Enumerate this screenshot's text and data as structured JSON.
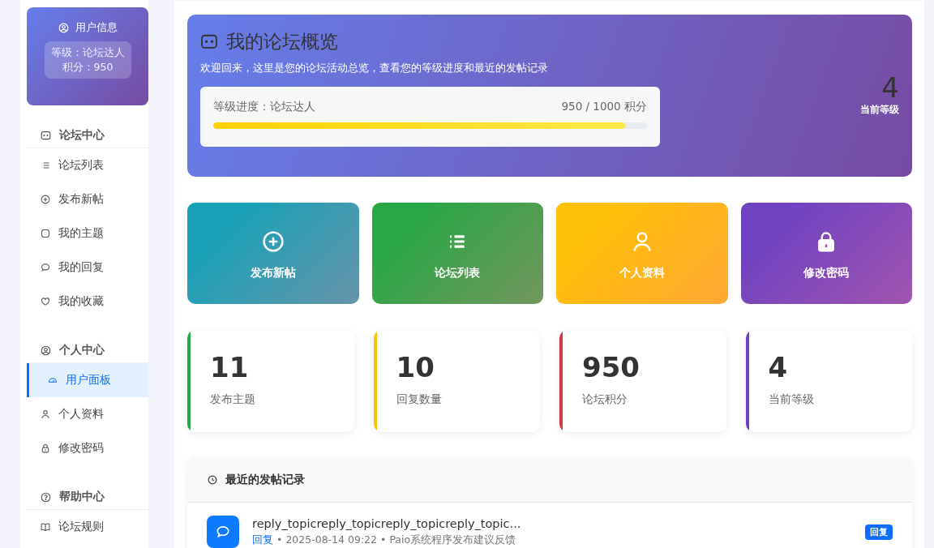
{
  "sidebar": {
    "user_card": {
      "title": "用户信息",
      "level": "等级：论坛达人",
      "points": "积分：950"
    },
    "sections": [
      {
        "title": "论坛中心",
        "items": [
          {
            "label": "论坛列表",
            "selected": false
          },
          {
            "label": "发布新帖",
            "selected": false
          },
          {
            "label": "我的主题",
            "selected": false
          },
          {
            "label": "我的回复",
            "selected": false
          },
          {
            "label": "我的收藏",
            "selected": false
          }
        ]
      },
      {
        "title": "个人中心",
        "items": [
          {
            "label": "用户面板",
            "selected": true
          },
          {
            "label": "个人资料",
            "selected": false
          },
          {
            "label": "修改密码",
            "selected": false
          }
        ]
      },
      {
        "title": "帮助中心",
        "items": [
          {
            "label": "论坛规则",
            "selected": false
          }
        ]
      }
    ]
  },
  "hero": {
    "title": "我的论坛概览",
    "subtitle": "欢迎回来，这里是您的论坛活动总览，查看您的等级进度和最近的发帖记录",
    "progress_label": "等级进度：论坛达人",
    "progress_value": "950 / 1000 积分",
    "level": 0.95,
    "current_level": "4",
    "current_level_label": "当前等级"
  },
  "quick_actions": [
    {
      "label": "发布新帖",
      "color": "#17a2b8"
    },
    {
      "label": "论坛列表",
      "color": "#28a745"
    },
    {
      "label": "个人资料",
      "color": "#ffc107"
    },
    {
      "label": "修改密码",
      "color": "#6f42c1"
    }
  ],
  "stats": [
    {
      "value": "11",
      "label": "发布主题",
      "color": "#28a745"
    },
    {
      "value": "10",
      "label": "回复数量",
      "color": "#ffc107"
    },
    {
      "value": "950",
      "label": "论坛积分",
      "color": "#dc3545"
    },
    {
      "value": "4",
      "label": "当前等级",
      "color": "#6f42c1"
    }
  ],
  "recent": {
    "title": "最近的发帖记录",
    "items": [
      {
        "title": "reply_topicreply_topicreply_topicreply_topic...",
        "meta": [
          {
            "kind": "link",
            "text": "回复"
          },
          {
            "kind": "sep",
            "text": "•"
          },
          {
            "kind": "text",
            "text": "2025-08-14 09:22"
          },
          {
            "kind": "sep",
            "text": "•"
          },
          {
            "kind": "text",
            "text": "Paio系统程序发布建议反馈"
          }
        ],
        "badge": "回复"
      }
    ]
  }
}
